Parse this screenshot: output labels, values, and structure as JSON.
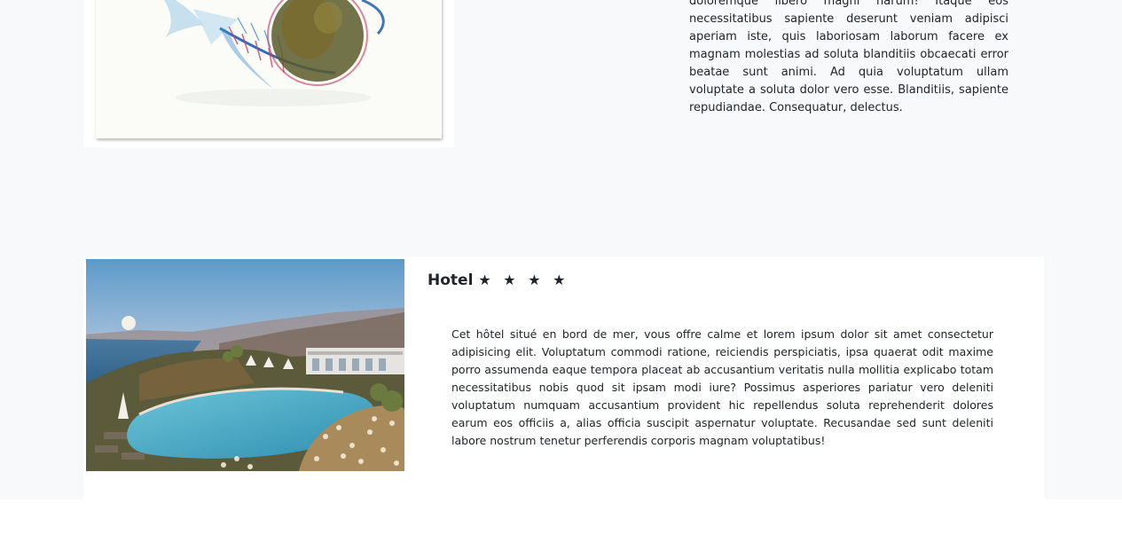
{
  "top_section": {
    "image_alt": "fish-xray-photo",
    "paragraph": "doloremque libero magni harum! Itaque eos necessitatibus sapiente deserunt veniam adipisci aperiam iste, quis laboriosam laborum facere ex magnam molestias ad soluta blanditiis obcaecati error beatae sunt animi. Ad quia voluptatum ullam voluptate a soluta dolor vero esse. Blanditiis, sapiente repudiandae. Consequatur, delectus."
  },
  "hotel_card": {
    "title": "Hotel",
    "stars": "★ ★ ★ ★",
    "rating": 4,
    "description": "Cet hôtel situé en bord de mer, vous offre calme et lorem ipsum dolor sit amet consectetur adipisicing elit. Voluptatum commodi ratione, reiciendis perspiciatis, ipsa quaerat odit maxime porro assumenda eaque tempora placeat ab accusantium veritatis nulla mollitia explicabo totam necessitatibus nobis quod sit ipsam modi iure? Possimus asperiores pariatur vero deleniti voluptatum numquam accusantium provident hic repellendus soluta reprehenderit dolores earum eos officiis a, alias officia suscipit aspernatur voluptate. Recusandae sed sunt deleniti labore nostrum tenetur perferendis corporis magnam voluptatibus!"
  },
  "colors": {
    "page_background": "#f8f9fa",
    "card_background": "#ffffff",
    "text": "#212529"
  }
}
